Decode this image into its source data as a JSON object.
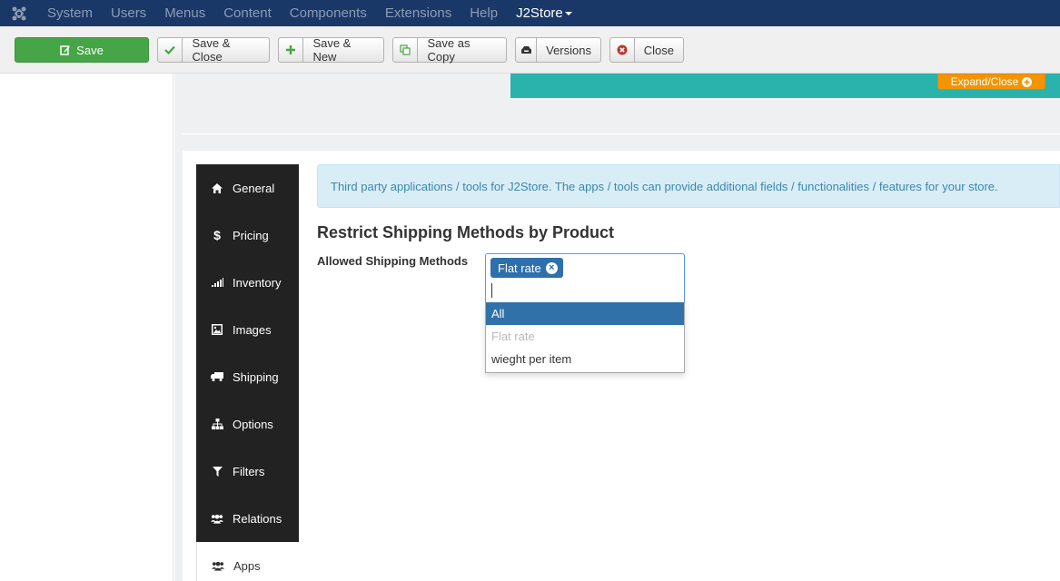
{
  "nav": {
    "items": [
      {
        "label": "System"
      },
      {
        "label": "Users"
      },
      {
        "label": "Menus"
      },
      {
        "label": "Content"
      },
      {
        "label": "Components"
      },
      {
        "label": "Extensions"
      },
      {
        "label": "Help"
      }
    ],
    "active_label": "J2Store"
  },
  "toolbar": {
    "save": "Save",
    "save_close": "Save & Close",
    "save_new": "Save & New",
    "save_copy": "Save as Copy",
    "versions": "Versions",
    "close": "Close"
  },
  "header": {
    "expand_label": "Expand/Close"
  },
  "tabs": [
    {
      "label": "General",
      "icon": "home-icon"
    },
    {
      "label": "Pricing",
      "icon": "dollar-icon"
    },
    {
      "label": "Inventory",
      "icon": "signal-icon"
    },
    {
      "label": "Images",
      "icon": "image-icon"
    },
    {
      "label": "Shipping",
      "icon": "truck-icon"
    },
    {
      "label": "Options",
      "icon": "sitemap-icon"
    },
    {
      "label": "Filters",
      "icon": "filter-icon"
    },
    {
      "label": "Relations",
      "icon": "users-icon"
    },
    {
      "label": "Apps",
      "icon": "users-icon"
    }
  ],
  "content": {
    "alert": "Third party applications / tools for J2Store. The apps / tools can provide additional fields / functionalities / features for your store.",
    "section_title": "Restrict Shipping Methods by Product",
    "field_label": "Allowed Shipping Methods",
    "selected_chip": "Flat rate",
    "options": [
      {
        "label": "All",
        "state": "highlighted"
      },
      {
        "label": "Flat rate",
        "state": "disabled"
      },
      {
        "label": "wieght per item",
        "state": "normal"
      }
    ]
  },
  "colors": {
    "topbar": "#1a3867",
    "save_green": "#46a546",
    "teal": "#2ab2ad",
    "expand_orange": "#f39400",
    "tab_dark": "#222222",
    "highlight_blue": "#3071a9"
  }
}
